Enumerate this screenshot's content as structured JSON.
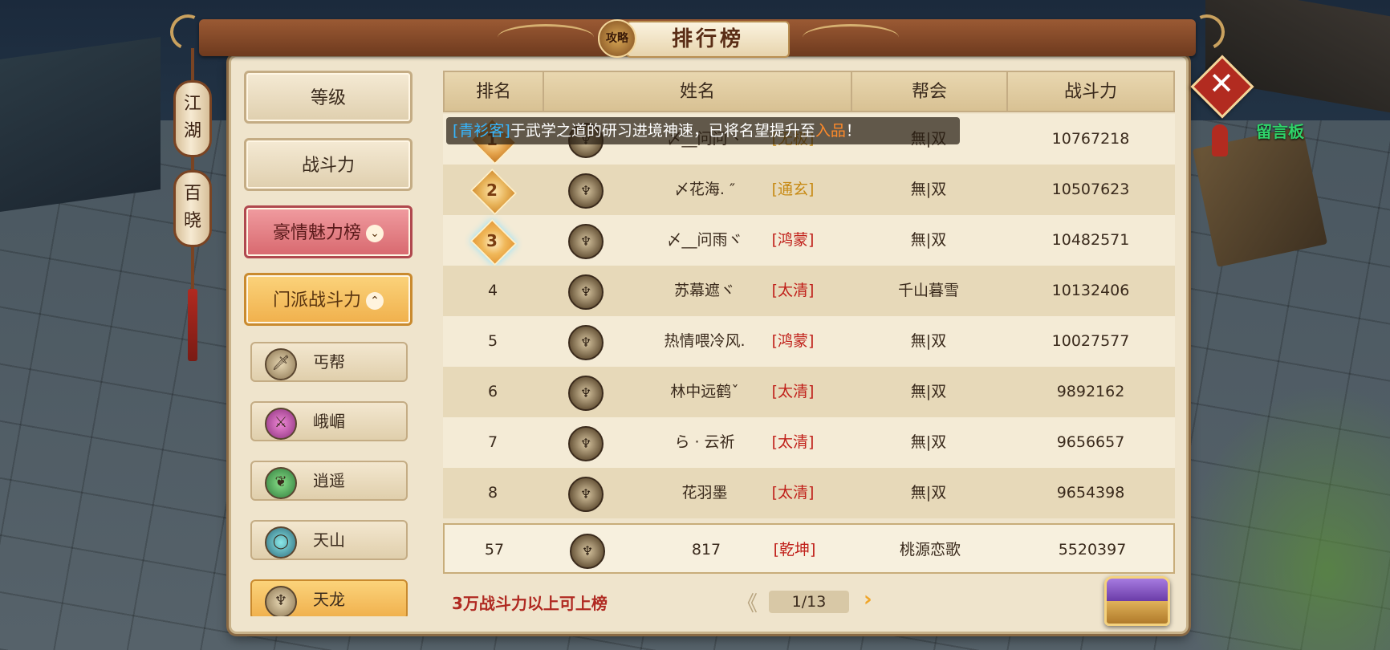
{
  "window": {
    "title": "排行榜",
    "seal_text": "攻略"
  },
  "lanterns": [
    "江湖",
    "百晓"
  ],
  "close_label": "✕",
  "board_label": "留言板",
  "sidebar": {
    "categories": [
      {
        "label": "等级"
      },
      {
        "label": "战斗力"
      },
      {
        "label": "豪情魅力榜",
        "chevron": "⌄"
      },
      {
        "label": "门派战斗力",
        "chevron": "⌃"
      }
    ],
    "sects": [
      {
        "label": "丐帮",
        "icon": "sword-icon"
      },
      {
        "label": "峨嵋",
        "icon": "crossed-swords-icon"
      },
      {
        "label": "逍遥",
        "icon": "leaf-icon"
      },
      {
        "label": "天山",
        "icon": "ring-icon"
      },
      {
        "label": "天龙",
        "icon": "dragon-icon"
      }
    ]
  },
  "table": {
    "headers": [
      "排名",
      "姓名",
      "帮会",
      "战斗力"
    ],
    "rows": [
      {
        "rank": "1",
        "name": "〆__问问丶",
        "realm": "[无极]",
        "guild": "無|双",
        "power": "10767218"
      },
      {
        "rank": "2",
        "name": "〆花海. ″",
        "realm": "[通玄]",
        "guild": "無|双",
        "power": "10507623"
      },
      {
        "rank": "3",
        "name": "〆__问雨ヾ",
        "realm": "[鸿蒙]",
        "guild": "無|双",
        "power": "10482571"
      },
      {
        "rank": "4",
        "name": "苏幕遮ヾ",
        "realm": "[太清]",
        "guild": "千山暮雪",
        "power": "10132406"
      },
      {
        "rank": "5",
        "name": "热情喂冷风.",
        "realm": "[鸿蒙]",
        "guild": "無|双",
        "power": "10027577"
      },
      {
        "rank": "6",
        "name": "林中远鹤ˇ",
        "realm": "[太清]",
        "guild": "無|双",
        "power": "9892162"
      },
      {
        "rank": "7",
        "name": "ら · 云祈",
        "realm": "[太清]",
        "guild": "無|双",
        "power": "9656657"
      },
      {
        "rank": "8",
        "name": "花羽墨",
        "realm": "[太清]",
        "guild": "無|双",
        "power": "9654398"
      }
    ],
    "my_row": {
      "rank": "57",
      "name": "817",
      "realm": "[乾坤]",
      "guild": "桃源恋歌",
      "power": "5520397"
    }
  },
  "broadcast": {
    "name": "[青衫客]",
    "text": "于武学之道的研习进境神速，已将名望提升至",
    "rank": "入品",
    "end": "！"
  },
  "footer": {
    "note": "3万战斗力以上可上榜",
    "page": "1/13",
    "prev": "《",
    "next": "›"
  },
  "colors": {
    "realm_gold": "#c78a14",
    "realm_red": "#c0201a",
    "accent": "#f0b04c"
  }
}
